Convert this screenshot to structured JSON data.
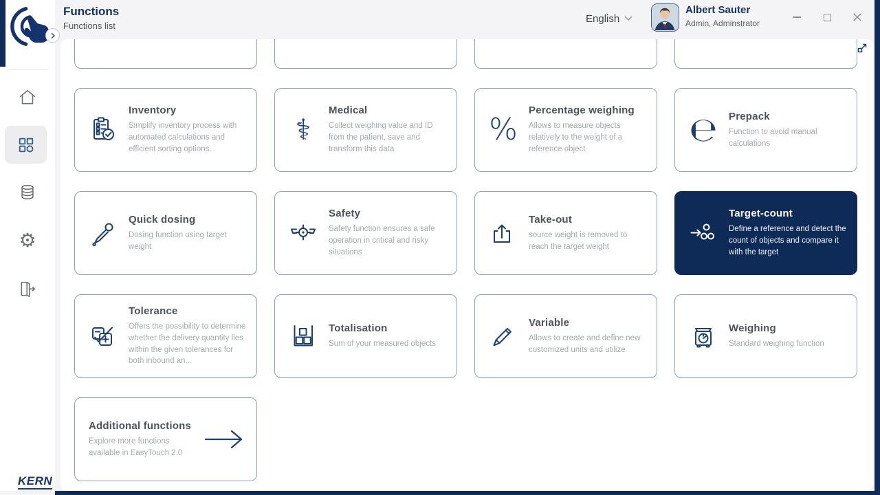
{
  "header": {
    "title": "Functions",
    "subtitle": "Functions list",
    "language": "English",
    "user_name": "Albert Sauter",
    "user_role": "Admin, Adminstrator"
  },
  "window_controls": {
    "icons": [
      "minimize-icon",
      "maximize-icon",
      "close-icon"
    ]
  },
  "sidebar": {
    "brand": "KERN",
    "items": [
      {
        "name": "home",
        "icon": "home-icon",
        "active": false
      },
      {
        "name": "functions",
        "icon": "apps-grid-icon",
        "active": true
      },
      {
        "name": "database",
        "icon": "database-icon",
        "active": false
      },
      {
        "name": "settings",
        "icon": "gear-icon",
        "active": false
      },
      {
        "name": "logout",
        "icon": "logout-icon",
        "active": false
      }
    ]
  },
  "content": {
    "expand_icon": "expand-icon",
    "partial_cards": 4,
    "cards": [
      {
        "title": "Inventory",
        "desc": "Simplify inventory process with automated calculations and efficient sorting options.",
        "icon": "inventory",
        "selected": false
      },
      {
        "title": "Medical",
        "desc": "Collect weighing value and ID from the patient, save and transform this data",
        "icon": "medical",
        "selected": false
      },
      {
        "title": "Percentage weighing",
        "desc": "Allows to measure objects relatively to the weight of a reference object",
        "icon": "percentage",
        "selected": false
      },
      {
        "title": "Prepack",
        "desc": "Function to avoid manual calculations",
        "icon": "prepack",
        "selected": false
      },
      {
        "title": "Quick dosing",
        "desc": "Dosing function using target weight",
        "icon": "quick-dosing",
        "selected": false
      },
      {
        "title": "Safety",
        "desc": "Safety function ensures a safe operation in critical and risky situations",
        "icon": "safety",
        "selected": false
      },
      {
        "title": "Take-out",
        "desc": "source weight is removed to reach the target weight",
        "icon": "take-out",
        "selected": false
      },
      {
        "title": "Target-count",
        "desc": "Define a reference and detect the count of objects and compare it with the target",
        "icon": "target-count",
        "selected": true
      },
      {
        "title": "Tolerance",
        "desc": "Offers the possibility to determine whether the delivery quantity lies within the given tolerances for both inbound an...",
        "icon": "tolerance",
        "selected": false
      },
      {
        "title": "Totalisation",
        "desc": "Sum of your measured objects",
        "icon": "totalisation",
        "selected": false
      },
      {
        "title": "Variable",
        "desc": "Allows to create and define new customized units and utilize",
        "icon": "variable",
        "selected": false
      },
      {
        "title": "Weighing",
        "desc": "Standard weighing function",
        "icon": "weighing",
        "selected": false
      },
      {
        "title": "Additional functions",
        "desc": "Explore more functions available in EasyTouch 2.0",
        "icon": "arrow-right",
        "selected": false,
        "variant": "additional"
      }
    ]
  },
  "colors": {
    "accent_navy": "#0e2b58",
    "card_border": "#8aa3c2",
    "active_icon_blue": "#33608d",
    "header_bg": "#f4f4f6"
  }
}
